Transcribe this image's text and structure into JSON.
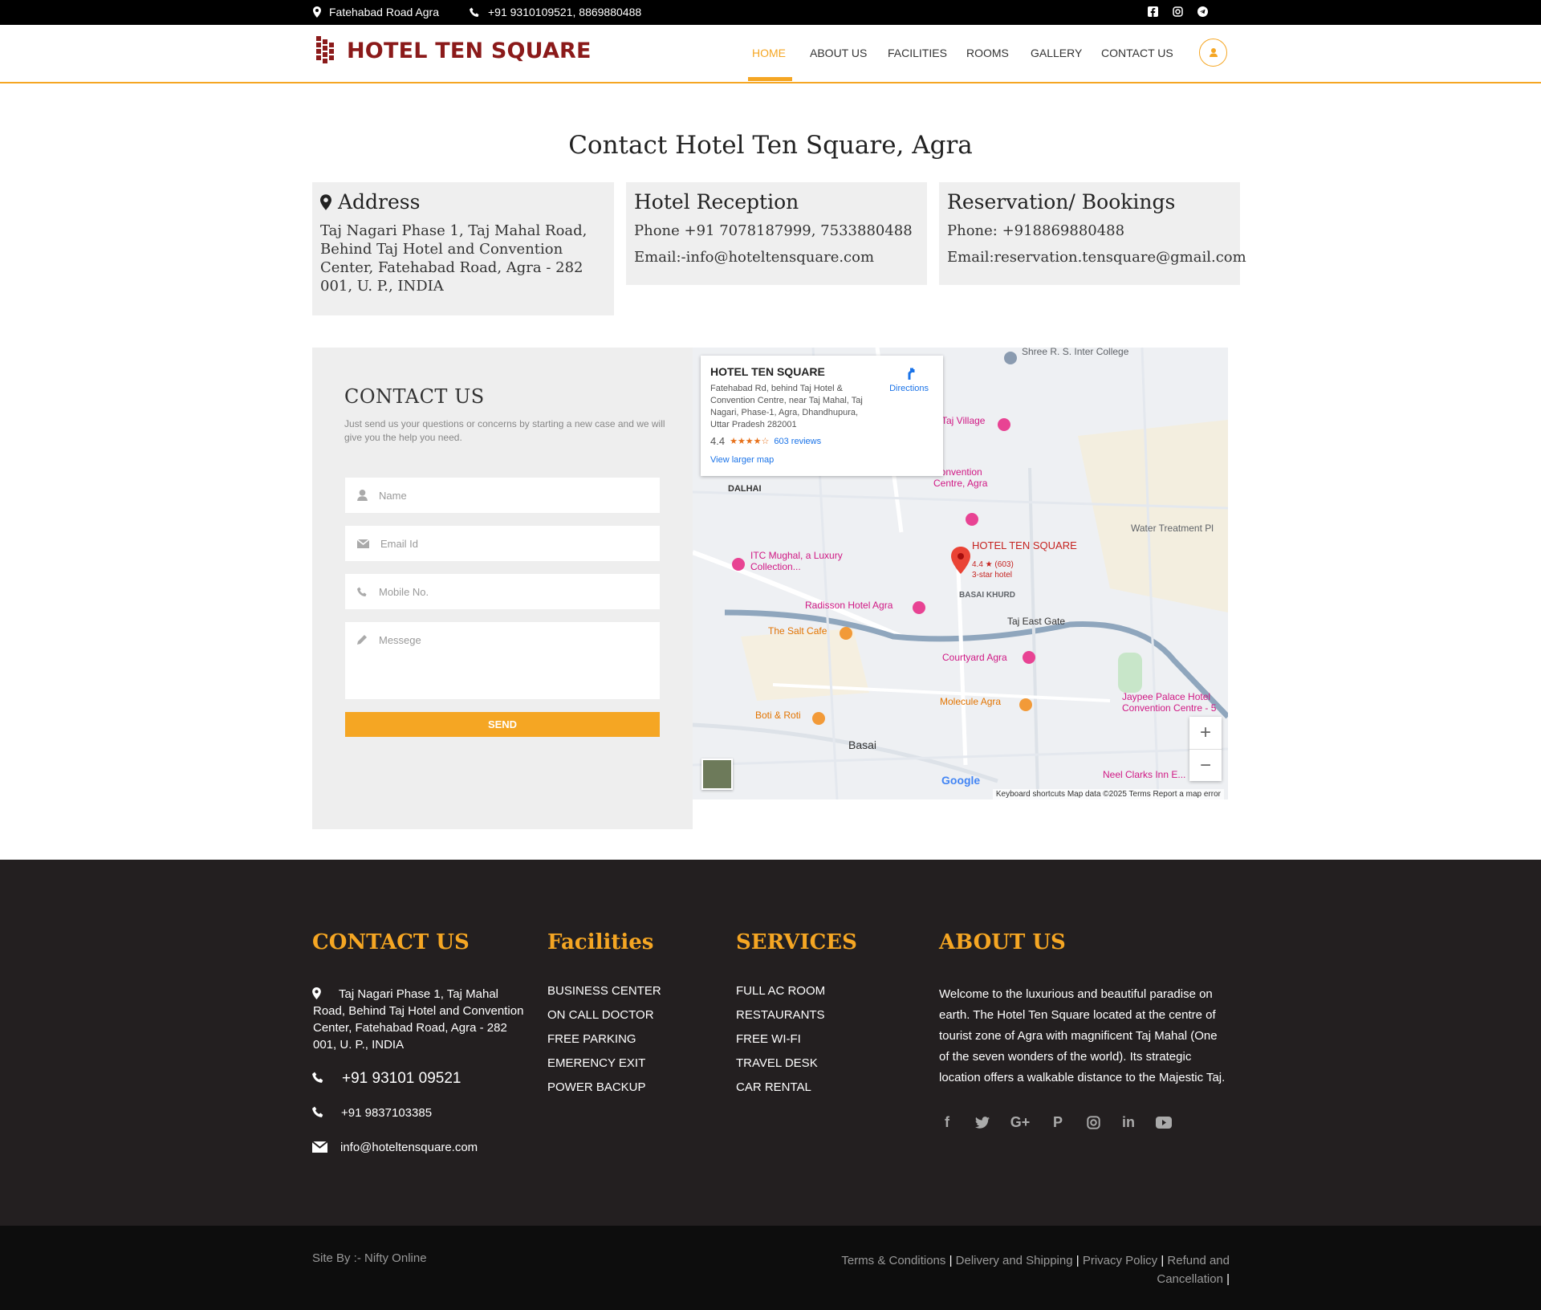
{
  "topbar": {
    "location": "Fatehabad Road Agra",
    "phones": "+91 9310109521, 8869880488"
  },
  "header": {
    "logo_text": "HOTEL TEN SQUARE",
    "nav": [
      "HOME",
      "ABOUT US",
      "FACILITIES",
      "ROOMS",
      "GALLERY",
      "CONTACT US"
    ],
    "active_nav": "HOME"
  },
  "page": {
    "title": "Contact Hotel Ten Square, Agra"
  },
  "info": {
    "address": {
      "title": "Address",
      "text": "Taj Nagari Phase 1, Taj Mahal Road, Behind Taj Hotel and Convention Center, Fatehabad Road, Agra - 282 001, U. P., INDIA"
    },
    "reception": {
      "title": "Hotel Reception",
      "phone": "Phone +91 7078187999, 7533880488",
      "email": "Email:-info@hoteltensquare.com"
    },
    "reservation": {
      "title": "Reservation/ Bookings",
      "phone": "Phone: +918869880488",
      "email": "Email:reservation.tensquare@gmail.com"
    }
  },
  "form": {
    "title": "CONTACT US",
    "description": "Just send us your questions or concerns by starting a new case and we will give you the help you need.",
    "name_placeholder": "Name",
    "email_placeholder": "Email Id",
    "mobile_placeholder": "Mobile No.",
    "message_placeholder": "Messege",
    "send_label": "SEND"
  },
  "map": {
    "card_name": "HOTEL TEN SQUARE",
    "card_address": "Fatehabad Rd, behind Taj Hotel & Convention Centre, near Taj Mahal, Taj Nagari, Phase-1, Agra, Dhandhupura, Uttar Pradesh 282001",
    "rating": "4.4",
    "stars": "★★★★☆",
    "reviews": "603 reviews",
    "larger_map": "View larger map",
    "directions": "Directions",
    "labels": {
      "college": "Shree R. S. Inter College",
      "taj_village": "Taj Village",
      "convention": "Convention Centre, Agra",
      "dalhai": "DALHAI",
      "water": "Water Treatment Pl",
      "hotel": "HOTEL TEN SQUARE",
      "hotel_sub": "4.4 ★ (603)",
      "hotel_type": "3-star hotel",
      "itc": "ITC Mughal, a Luxury Collection...",
      "basai_khurd": "BASAI KHURD",
      "radisson": "Radisson Hotel Agra",
      "salt_cafe": "The Salt Cafe",
      "taj_east": "Taj East Gate",
      "courtyard": "Courtyard Agra",
      "molecule": "Molecule Agra",
      "jaypee": "Jaypee Palace Hotel Convention Centre - 5",
      "boti": "Boti & Roti",
      "basai": "Basai",
      "neel": "Neel Clarks Inn E..."
    },
    "attribution": "Keyboard shortcuts    Map data ©2025    Terms    Report a map error",
    "google": "Google"
  },
  "footer": {
    "contact_title": "CONTACT US",
    "contact_address": "Taj Nagari Phase 1, Taj Mahal Road, Behind Taj Hotel and Convention Center, Fatehabad Road, Agra - 282 001, U. P., INDIA",
    "phone1": "+91 93101 09521",
    "phone2": "+91 9837103385",
    "email": "info@hoteltensquare.com",
    "facilities_title": "Facilities",
    "facilities": [
      "BUSINESS CENTER",
      "ON CALL DOCTOR",
      "FREE PARKING",
      "EMERENCY EXIT",
      "POWER BACKUP"
    ],
    "services_title": "SERVICES",
    "services": [
      "FULL AC ROOM",
      "RESTAURANTS",
      "FREE WI-FI",
      "TRAVEL DESK",
      "CAR RENTAL"
    ],
    "about_title": "ABOUT US",
    "about_text": "Welcome to the luxurious and beautiful paradise on earth. The Hotel Ten Square located at the centre of tourist zone of Agra with magnificent Taj Mahal (One of the seven wonders of the world). Its strategic location offers a walkable distance to the Majestic Taj."
  },
  "bottombar": {
    "site_by": "Site By :- Nifty Online",
    "links": [
      "Terms & Conditions",
      "Delivery and Shipping",
      "Privacy Policy",
      "Refund and Cancellation"
    ]
  },
  "colors": {
    "accent": "#f5a623",
    "brand": "#8b1a1a",
    "footer_bg": "#231f20"
  }
}
